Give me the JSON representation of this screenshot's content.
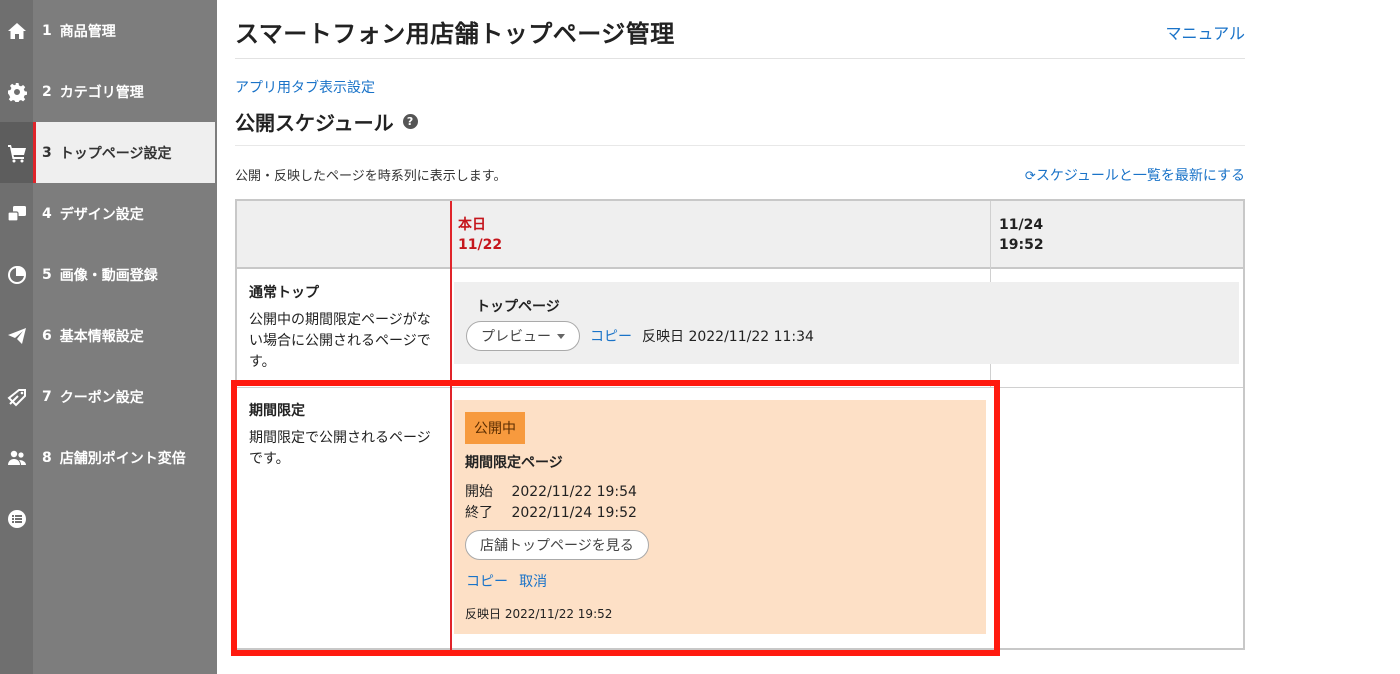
{
  "sidebar": {
    "items": [
      {
        "num": "1",
        "label": "商品管理"
      },
      {
        "num": "2",
        "label": "カテゴリ管理"
      },
      {
        "num": "3",
        "label": "トップページ設定"
      },
      {
        "num": "4",
        "label": "デザイン設定"
      },
      {
        "num": "5",
        "label": "画像・動画登録"
      },
      {
        "num": "6",
        "label": "基本情報設定"
      },
      {
        "num": "7",
        "label": "クーポン設定"
      },
      {
        "num": "8",
        "label": "店舗別ポイント変倍"
      }
    ],
    "active_index": 2,
    "icons": [
      "home-icon",
      "gear-icon",
      "cart-icon",
      "design-icon",
      "pie-chart-icon",
      "paper-plane-icon",
      "coupon-icon",
      "users-icon",
      "list-icon"
    ]
  },
  "header": {
    "title": "スマートフォン用店舗トップページ管理",
    "manual_link": "マニュアル"
  },
  "app_tab_link": "アプリ用タブ表示設定",
  "schedule": {
    "title": "公開スケジュール",
    "help": "?",
    "description": "公開・反映したページを時系列に表示します。",
    "refresh_link": "スケジュールと一覧を最新にする",
    "columns": {
      "today_label": "本日",
      "today_date": "11/22",
      "future_date": "11/24",
      "future_time": "19:52"
    },
    "normal_row": {
      "heading": "通常トップ",
      "desc": "公開中の期間限定ページがない場合に公開されるページです。",
      "card_title": "トップページ",
      "preview_button": "プレビュー",
      "copy_link": "コピー",
      "reflected": "反映日 2022/11/22 11:34"
    },
    "limited_row": {
      "heading": "期間限定",
      "desc": "期間限定で公開されるページです。",
      "status_badge": "公開中",
      "card_title": "期間限定ページ",
      "start_label": "開始",
      "start_value": "2022/11/22 19:54",
      "end_label": "終了",
      "end_value": "2022/11/24 19:52",
      "view_button": "店舗トップページを見る",
      "copy_link": "コピー",
      "cancel_link": "取消",
      "reflected": "反映日 2022/11/22 19:52"
    }
  },
  "colors": {
    "accent_red": "#e0242a",
    "highlight_red": "#ff1a0f",
    "link_blue": "#1a73c8",
    "badge_orange": "#f79a3e",
    "card_peach": "#fde0c6"
  }
}
